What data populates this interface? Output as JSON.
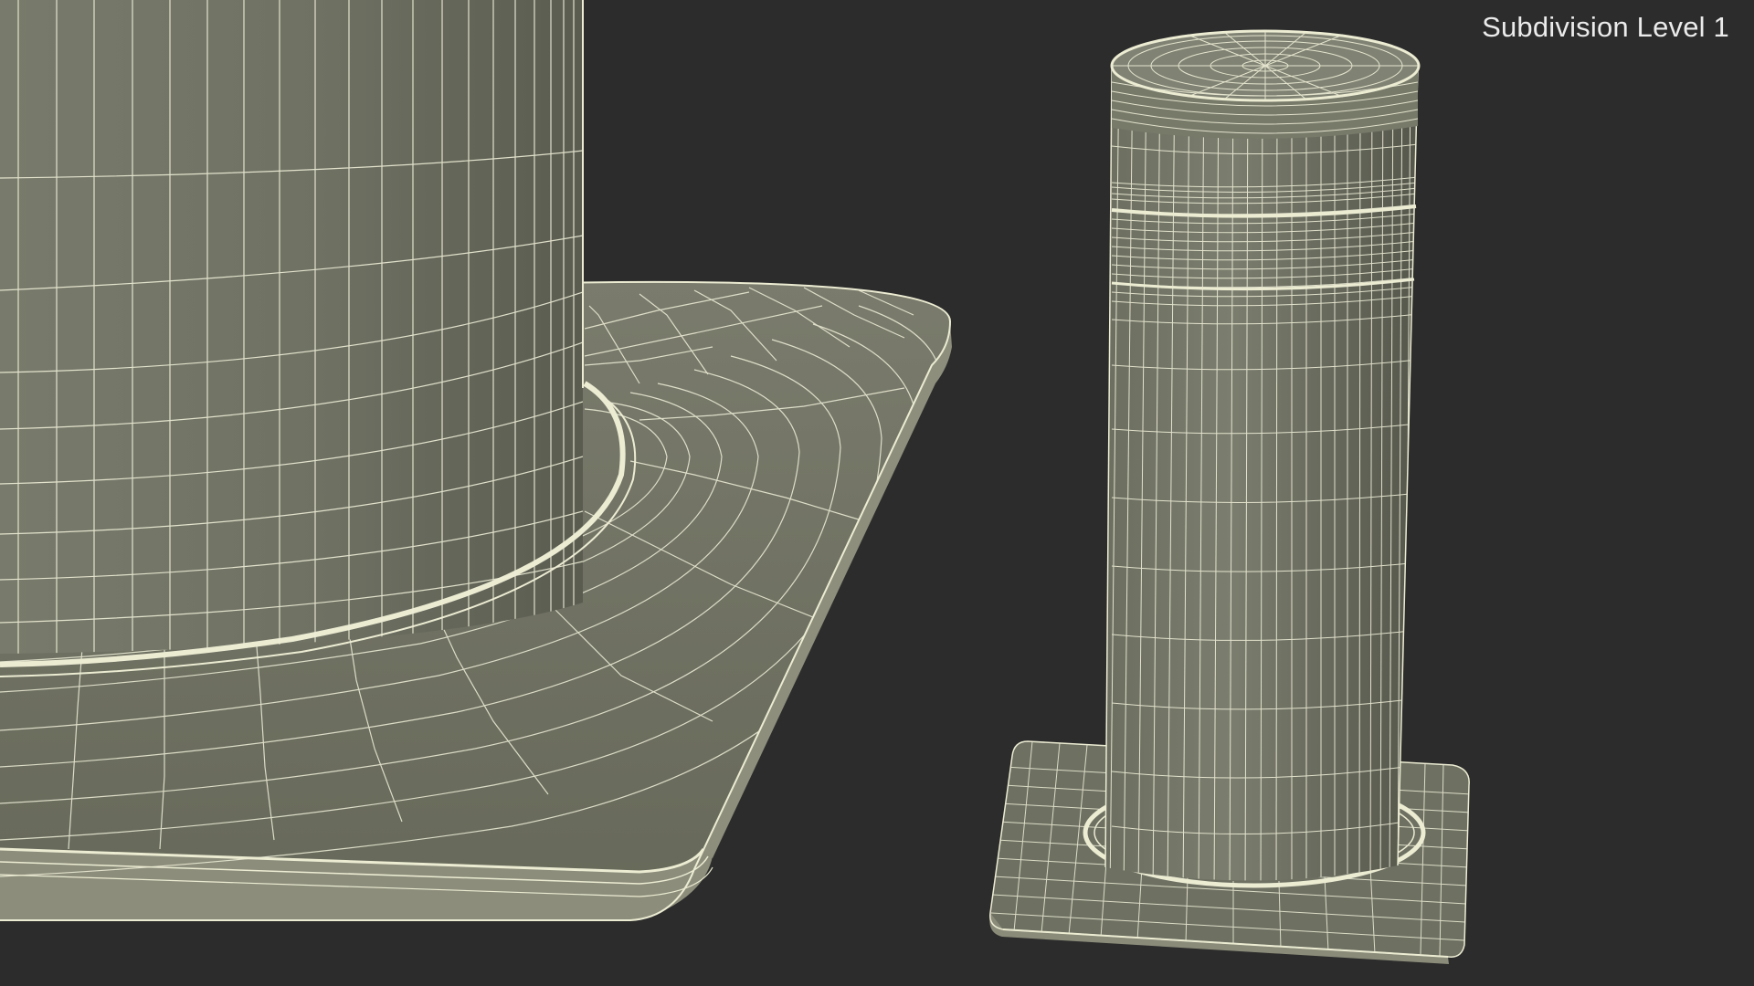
{
  "scene": {
    "subdivision_label": "Subdivision Level 1"
  },
  "colors": {
    "background": "#2c2c2c",
    "surface_light": "#7d7e6f",
    "surface_dark": "#5c5d51",
    "wire": "#f2f2dc",
    "rim": "#e8e8cf"
  }
}
